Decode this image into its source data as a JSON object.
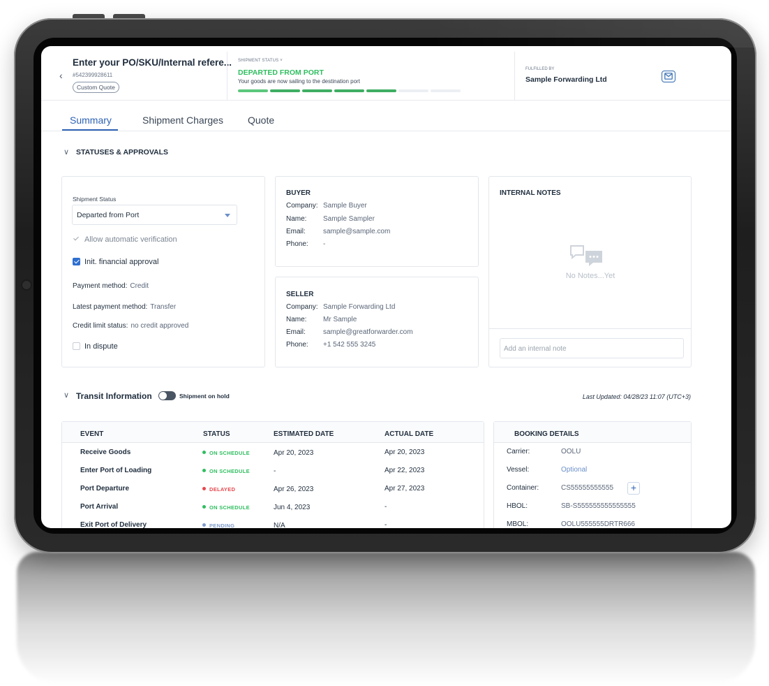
{
  "header": {
    "back_glyph": "‹",
    "po_title": "Enter your PO/SKU/Internal refere...",
    "po_number": "#542399928611",
    "quote_badge": "Custom Quote",
    "shipment_status_label": "SHIPMENT STATUS ˅",
    "shipment_status_value": "DEPARTED FROM PORT",
    "shipment_status_desc": "Your goods are now sailing to the destination port",
    "progress_steps": [
      {
        "state": "done",
        "color": "#5cc77c"
      },
      {
        "state": "done",
        "color": "#3fae63"
      },
      {
        "state": "done",
        "color": "#3fae63"
      },
      {
        "state": "done",
        "color": "#3fae63"
      },
      {
        "state": "done",
        "color": "#3fae63"
      },
      {
        "state": "todo",
        "color": "#eceff3"
      },
      {
        "state": "todo",
        "color": "#eceff3"
      }
    ],
    "fulfilled_by_label": "FULFILLED BY",
    "fulfilled_by_value": "Sample Forwarding Ltd",
    "mail_icon": "envelope-icon"
  },
  "tabs": [
    {
      "label": "Summary",
      "active": true
    },
    {
      "label": "Shipment Charges",
      "active": false
    },
    {
      "label": "Quote",
      "active": false
    }
  ],
  "statuses_section": {
    "chevron": "∨",
    "title": "STATUSES & APPROVALS",
    "shipment_status_label": "Shipment Status",
    "shipment_status_selected": "Departed from Port",
    "allow_auto_verification": "Allow automatic verification",
    "init_financial_approval": "Init. financial approval",
    "payment_method_label": "Payment method:",
    "payment_method_value": "Credit",
    "latest_payment_label": "Latest payment method:",
    "latest_payment_value": "Transfer",
    "credit_limit_label": "Credit limit status:",
    "credit_limit_value": "no credit approved",
    "in_dispute": "In dispute"
  },
  "buyer": {
    "title": "BUYER",
    "rows": [
      {
        "k": "Company:",
        "v": "Sample Buyer"
      },
      {
        "k": "Name:",
        "v": "Sample Sampler"
      },
      {
        "k": "Email:",
        "v": "sample@sample.com"
      },
      {
        "k": "Phone:",
        "v": "-"
      }
    ]
  },
  "seller": {
    "title": "SELLER",
    "rows": [
      {
        "k": "Company:",
        "v": "Sample Forwarding Ltd"
      },
      {
        "k": "Name:",
        "v": "Mr Sample"
      },
      {
        "k": "Email:",
        "v": "sample@greatforwarder.com"
      },
      {
        "k": "Phone:",
        "v": "+1 542 555 3245"
      }
    ]
  },
  "internal_notes": {
    "title": "INTERNAL NOTES",
    "empty_text": "No Notes...Yet",
    "input_placeholder": "Add an internal note"
  },
  "transit": {
    "chevron": "∨",
    "title": "Transit Information",
    "toggle_label": "Shipment on hold",
    "last_updated": "Last Updated: 04/28/23 11:07 (UTC+3)",
    "columns": [
      "EVENT",
      "STATUS",
      "ESTIMATED DATE",
      "ACTUAL DATE"
    ],
    "rows": [
      {
        "event": "Receive Goods",
        "status": "ON SCHEDULE",
        "status_color": "#2fbe5f",
        "estimated": "Apr 20, 2023",
        "actual": "Apr 20, 2023"
      },
      {
        "event": "Enter Port of Loading",
        "status": "ON SCHEDULE",
        "status_color": "#2fbe5f",
        "estimated": "-",
        "actual": "Apr 22, 2023"
      },
      {
        "event": "Port Departure",
        "status": "DELAYED",
        "status_color": "#e5484d",
        "estimated": "Apr 26, 2023",
        "actual": "Apr 27, 2023"
      },
      {
        "event": "Port Arrival",
        "status": "ON SCHEDULE",
        "status_color": "#2fbe5f",
        "estimated": "Jun 4, 2023",
        "actual": "-"
      },
      {
        "event": "Exit Port of Delivery",
        "status": "PENDING",
        "status_color": "#7f9cc9",
        "estimated": "N/A",
        "actual": "-"
      }
    ]
  },
  "booking": {
    "title": "BOOKING DETAILS",
    "rows": [
      {
        "k": "Carrier:",
        "v": "OOLU"
      },
      {
        "k": "Vessel:",
        "v": "Optional"
      },
      {
        "k": "Container:",
        "v": "CS55555555555"
      },
      {
        "k": "HBOL:",
        "v": "SB-S555555555555555"
      },
      {
        "k": "MBOL:",
        "v": "OOLU555555DRTR666"
      }
    ],
    "add_container_glyph": "+"
  }
}
